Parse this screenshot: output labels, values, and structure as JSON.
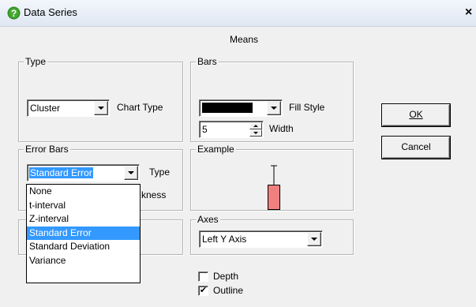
{
  "window": {
    "title": "Data Series",
    "close_glyph": "×"
  },
  "subtitle": "Means",
  "type_group": {
    "label": "Type",
    "chart_type_value": "Cluster",
    "chart_type_label": "Chart Type"
  },
  "bars_group": {
    "label": "Bars",
    "fill_style_label": "Fill Style",
    "fill_color": "#000000",
    "width_value": "5",
    "width_label": "Width"
  },
  "error_bars_group": {
    "label": "Error Bars",
    "type_value": "Standard Error",
    "type_label": "Type",
    "thickness_label_partial": "kness",
    "dropdown_options": [
      {
        "label": "None"
      },
      {
        "label": "t-interval"
      },
      {
        "label": "Z-interval"
      },
      {
        "label": "Standard Error"
      },
      {
        "label": "Standard Deviation"
      },
      {
        "label": "Variance"
      }
    ],
    "highlighted_option": "Standard Error"
  },
  "example_group": {
    "label": "Example",
    "bar_color": "#f08080"
  },
  "axes_group": {
    "label": "Axes",
    "axis_value": "Left Y Axis"
  },
  "checkboxes": {
    "depth_label": "Depth",
    "depth_checked": false,
    "outline_label": "Outline",
    "outline_checked": true,
    "check_glyph": "✔"
  },
  "buttons": {
    "ok_label": "OK",
    "cancel_label": "Cancel"
  }
}
